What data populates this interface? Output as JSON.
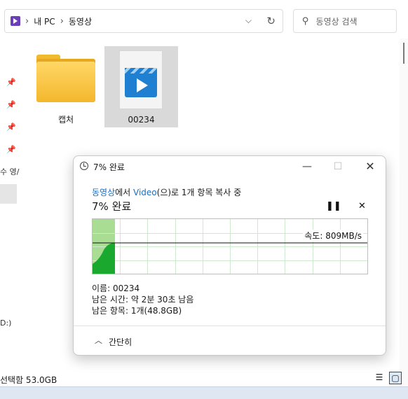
{
  "explorer": {
    "breadcrumb": [
      "내 PC",
      "동영상"
    ],
    "search_placeholder": "동영상 검색",
    "side_partial_1": "수 영/",
    "side_partial_2": "D:)",
    "status": "선택함 53.0GB",
    "files": [
      {
        "name": "캡처",
        "type": "folder"
      },
      {
        "name": "00234",
        "type": "video-file"
      }
    ]
  },
  "dialog": {
    "title": "7% 완료",
    "copy_source": "동영상",
    "copy_text_1": "에서 ",
    "copy_dest": "Video",
    "copy_text_2": "(으)로 1개 항목 복사 중",
    "percent_label": "7% 완료",
    "progress_percent": 7,
    "speed": "속도: 809MB/s",
    "name_line": "이름: 00234",
    "time_left": "남은 시간: 약 2분 30초 남음",
    "items_left": "남은 항목: 1개(48.8GB)",
    "fewer_details": "간단히"
  },
  "colors": {
    "link": "#1a6fc4",
    "graph_fill": "#1aa82e",
    "graph_progress": "#a9dd93"
  }
}
